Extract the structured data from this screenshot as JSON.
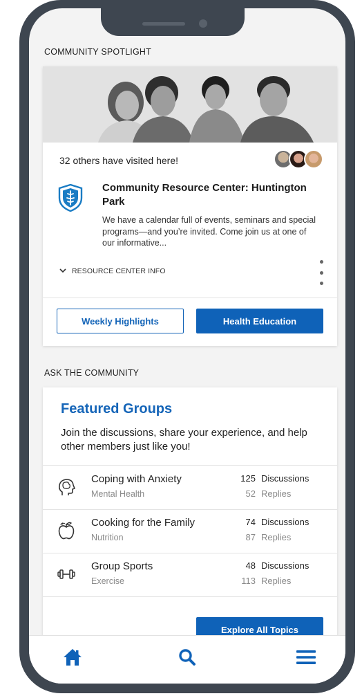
{
  "colors": {
    "accent": "#0f62b8",
    "frame": "#3e4650",
    "muted": "#8a8a8a"
  },
  "spotlight": {
    "section_label": "COMMUNITY SPOTLIGHT",
    "visited_text": "32 others have visited here!",
    "org_title": "Community Resource Center: Huntington Park",
    "description": "We have a calendar full of events, seminars and special programs—and you’re invited. Come join us at one of our informative...",
    "info_toggle": "RESOURCE CENTER INFO",
    "buttons": {
      "weekly": "Weekly Highlights",
      "health": "Health Education"
    }
  },
  "community": {
    "section_label": "ASK THE COMMUNITY",
    "title": "Featured Groups",
    "description": "Join the discussions, share your experience, and help other members just like you!",
    "groups": [
      {
        "name": "Coping with Anxiety",
        "category": "Mental Health",
        "discussions": "125",
        "discussions_label": "Discussions",
        "replies": "52",
        "replies_label": "Replies",
        "icon": "brain-head-icon"
      },
      {
        "name": "Cooking for the Family",
        "category": "Nutrition",
        "discussions": "74",
        "discussions_label": "Discussions",
        "replies": "87",
        "replies_label": "Replies",
        "icon": "apple-icon"
      },
      {
        "name": "Group Sports",
        "category": "Exercise",
        "discussions": "48",
        "discussions_label": "Discussions",
        "replies": "113",
        "replies_label": "Replies",
        "icon": "dumbbell-icon"
      }
    ],
    "explore_button": "Explore All Topics"
  },
  "bottom_nav": {
    "items": [
      "home-icon",
      "search-icon",
      "menu-icon"
    ]
  }
}
